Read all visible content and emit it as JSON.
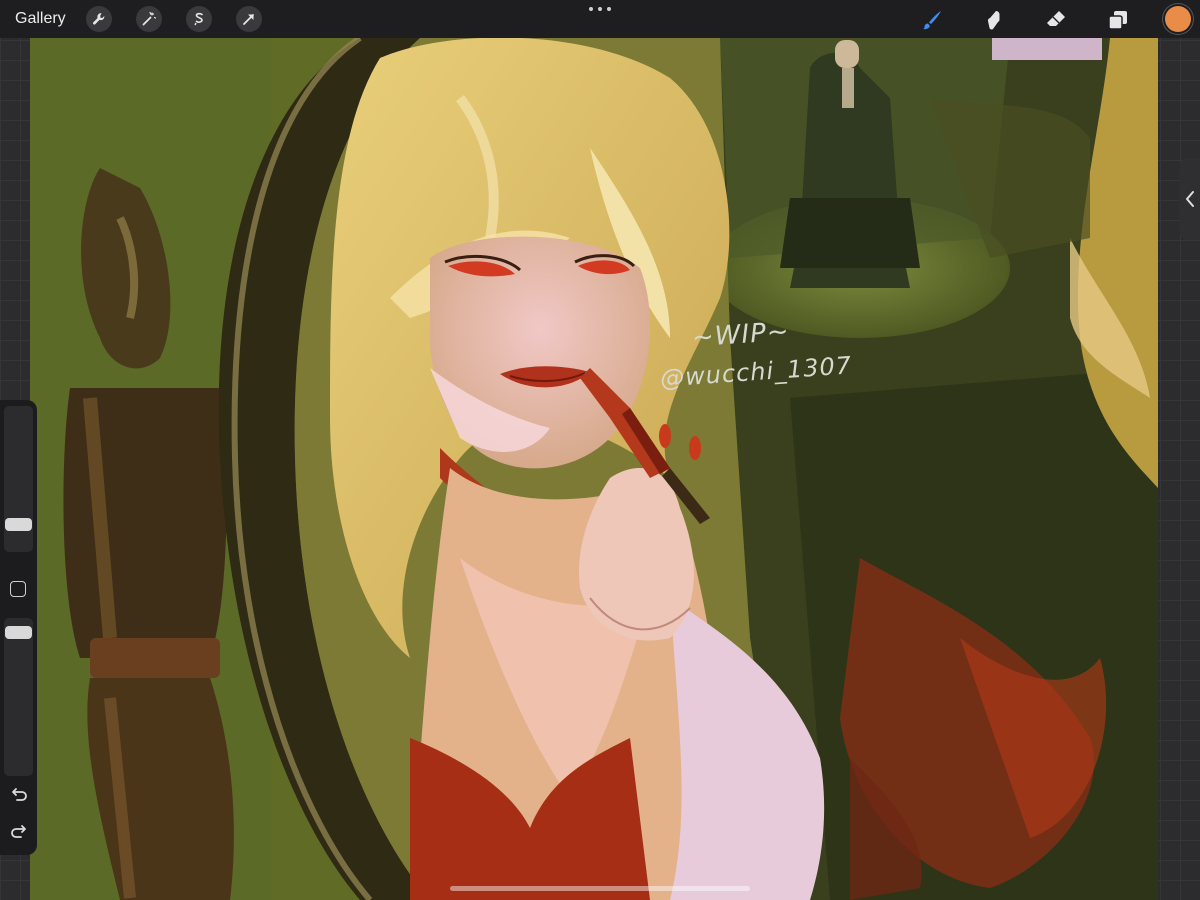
{
  "topbar": {
    "gallery_label": "Gallery",
    "left_tools": [
      "wrench-icon",
      "magic-wand-icon",
      "selection-icon",
      "transform-arrow-icon"
    ],
    "right_tools": [
      "brush-icon",
      "smudge-icon",
      "eraser-icon",
      "layers-icon"
    ],
    "active_tool": "brush-icon",
    "active_color": "#e98c47"
  },
  "canvas": {
    "watermark_line1": "~WIP~",
    "watermark_line2": "@wucchi_1307"
  },
  "sidebar": {
    "brush_size": 0.22,
    "brush_opacity": 0.9
  }
}
